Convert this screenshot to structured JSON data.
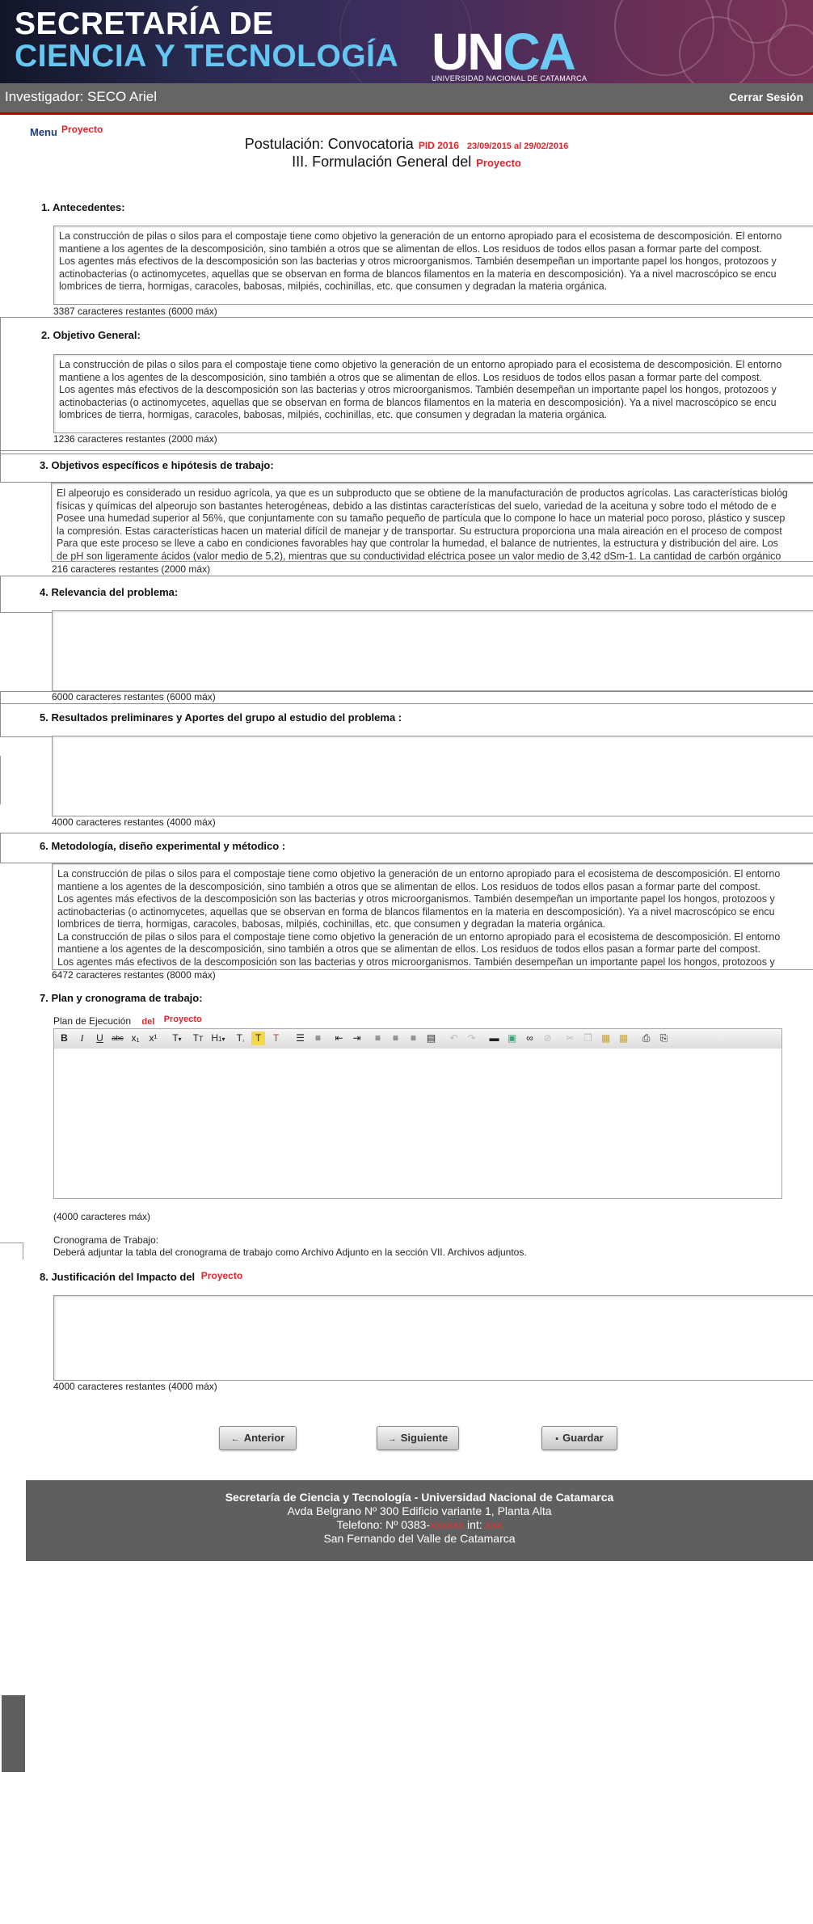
{
  "banner": {
    "line1": "SECRETARÍA DE",
    "line2": "CIENCIA Y TECNOLOGÍA",
    "logo_main": "UN",
    "logo_accent": "CA",
    "logo_sub": "UNIVERSIDAD NACIONAL DE CATAMARCA"
  },
  "userbar": {
    "user": "Investigador: SECO Ariel",
    "logout": "Cerrar Sesión"
  },
  "breadcrumb": {
    "menu": "Menu",
    "current": "Proyecto"
  },
  "header": {
    "postulacion": "Postulación: Convocatoria",
    "pid": "PID  2016",
    "dates": "23/09/2015 al 29/02/2016",
    "section_title": "III. Formulación General del",
    "section_title_red": "Proyecto"
  },
  "sections": {
    "s1": {
      "label": "1.  Antecedentes:",
      "text": "La construcción de pilas o silos para el compostaje tiene como objetivo la generación de un entorno apropiado para el ecosistema de descomposición. El entorno\nmantiene a los agentes de la descomposición, sino también a otros que se alimentan de ellos. Los residuos de todos ellos pasan a formar parte del compost.\nLos agentes más efectivos de la descomposición son las bacterias y otros microorganismos. También desempeñan un importante papel los hongos, protozoos y\nactinobacterias (o actinomycetes, aquellas que se observan en forma de blancos filamentos en la materia en descomposición). Ya a nivel macroscópico se encu\nlombrices de tierra, hormigas, caracoles, babosas, milpiés, cochinillas, etc. que consumen y degradan la materia orgánica.\n\nLa construcción de pilas o silos para el compostaje tiene como objetivo la generación de un entorno apropiado para el ecosistema de descomposición. El entorno",
      "counter": "3387 caracteres restantes (6000 máx)"
    },
    "s2": {
      "label": "2.  Objetivo General:",
      "text": "La construcción de pilas o silos para el compostaje tiene como objetivo la generación de un entorno apropiado para el ecosistema de descomposición. El entorno\nmantiene a los agentes de la descomposición, sino también a otros que se alimentan de ellos. Los residuos de todos ellos pasan a formar parte del compost.\nLos agentes más efectivos de la descomposición son las bacterias y otros microorganismos. También desempeñan un importante papel los hongos, protozoos y\nactinobacterias (o actinomycetes, aquellas que se observan en forma de blancos filamentos en la materia en descomposición). Ya a nivel macroscópico se encu\nlombrices de tierra, hormigas, caracoles, babosas, milpiés, cochinillas, etc. que consumen y degradan la materia orgánica.",
      "counter": "1236 caracteres restantes (2000 máx)"
    },
    "s3": {
      "label": "3.  Objetivos específicos e hipótesis de trabajo:",
      "text": "El alpeorujo es considerado un residuo agrícola, ya que es un subproducto que se obtiene de la manufacturación de productos agrícolas. Las características biológ\nfísicas y químicas del alpeorujo son bastantes heterogéneas, debido a las distintas características del suelo, variedad de la aceituna y sobre todo el método de e\nPosee una humedad superior al 56%, que conjuntamente con su tamaño pequeño de partícula que lo compone lo hace un material poco poroso, plástico y suscep\nla compresión. Estas características hacen un material difícil de manejar y de transportar. Su estructura proporciona una mala aireación en el proceso de compost\nPara que este proceso se lleve a cabo en condiciones favorables hay que controlar la humedad, el balance de nutrientes, la estructura y distribución del aire. Los\nde pH son ligeramente ácidos (valor medio de 5,2), mientras que su conductividad eléctrica posee un valor medio de 3,42 dSm-1. La cantidad de carbón orgánico",
      "counter": "216 caracteres restantes (2000 máx)"
    },
    "s4": {
      "label": "4.  Relevancia del problema:",
      "text": "",
      "counter": "6000 caracteres restantes (6000 máx)"
    },
    "s5": {
      "label": "5.  Resultados preliminares y Aportes del grupo al estudio del problema :",
      "text": "",
      "counter": "4000 caracteres restantes (4000 máx)"
    },
    "s6": {
      "label": "6.  Metodología, diseño experimental y métodico :",
      "text": "La construcción de pilas o silos para el compostaje tiene como objetivo la generación de un entorno apropiado para el ecosistema de descomposición. El entorno\nmantiene a los agentes de la descomposición, sino también a otros que se alimentan de ellos. Los residuos de todos ellos pasan a formar parte del compost.\nLos agentes más efectivos de la descomposición son las bacterias y otros microorganismos. También desempeñan un importante papel los hongos, protozoos y\nactinobacterias (o actinomycetes, aquellas que se observan en forma de blancos filamentos en la materia en descomposición). Ya a nivel macroscópico se encu\nlombrices de tierra, hormigas, caracoles, babosas, milpiés, cochinillas, etc. que consumen y degradan la materia orgánica.\nLa construcción de pilas o silos para el compostaje tiene como objetivo la generación de un entorno apropiado para el ecosistema de descomposición. El entorno\nmantiene a los agentes de la descomposición, sino también a otros que se alimentan de ellos. Los residuos de todos ellos pasan a formar parte del compost.\nLos agentes más efectivos de la descomposición son las bacterias y otros microorganismos. También desempeñan un importante papel los hongos, protozoos y",
      "counter": "6472 caracteres restantes (8000 máx)"
    },
    "s7": {
      "label": "7.  Plan y cronograma de trabajo:",
      "plan_label": "Plan de Ejecución",
      "plan_del": "del",
      "plan_red": "Proyecto",
      "max": "(4000 caracteres máx)",
      "crono_label": "Cronograma de Trabajo:",
      "crono_text": "Deberá adjuntar la tabla del cronograma de trabajo como Archivo Adjunto en la sección VII. Archivos adjuntos."
    },
    "s8": {
      "label": "8.  Justificación del Impacto del",
      "label_red": "Proyecto",
      "text": "",
      "counter": "4000 caracteres restantes (4000 máx)"
    }
  },
  "toolbar": {
    "bold": "B",
    "italic": "I",
    "underline": "U",
    "strike": "abc",
    "subscript": "x₁",
    "superscript": "x¹",
    "font_size": "T",
    "font_family": "T",
    "heading": "H",
    "format": "T",
    "remove_format": "T"
  },
  "buttons": {
    "prev": "Anterior",
    "next": "Siguiente",
    "save": "Guardar"
  },
  "footer": {
    "line1": "Secretaría de Ciencia y Tecnología - Universidad Nacional de Catamarca",
    "line2": "Avda Belgrano Nº 300 Edificio variante 1, Planta Alta",
    "line3_prefix": "Telefono: Nº 0383-",
    "line3_mid": "     int:",
    "line4": "San Fernando del Valle de Catamarca"
  }
}
